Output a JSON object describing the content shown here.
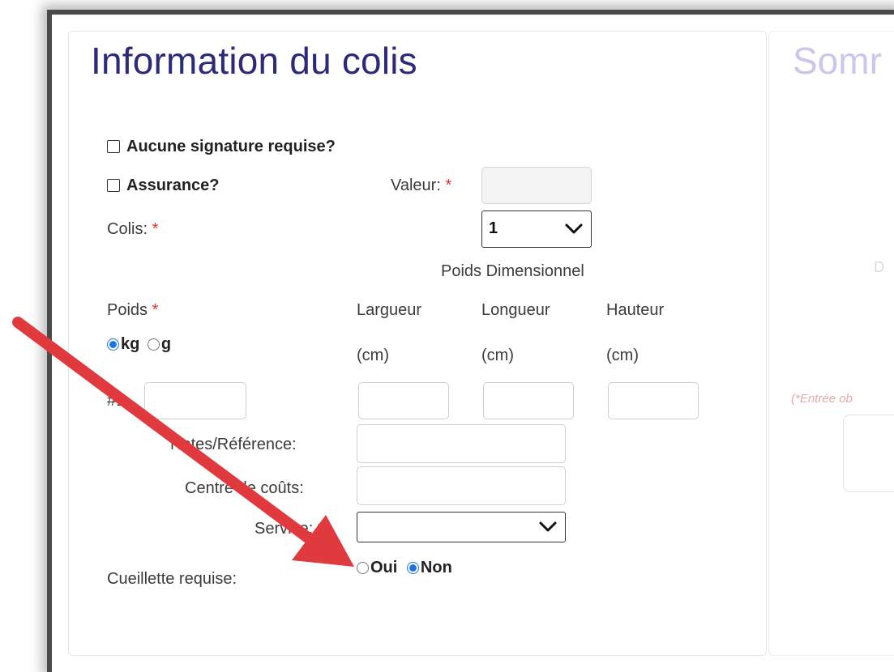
{
  "section_title": "Information du colis",
  "summary_title": "Somr",
  "options": {
    "no_signature_label": "Aucune signature requise?",
    "insurance_label": "Assurance?",
    "value_label": "Valeur:",
    "required_mark": "*"
  },
  "packages": {
    "label": "Colis:",
    "selected": "1"
  },
  "dimensional_weight_label": "Poids Dimensionnel",
  "weight": {
    "label": "Poids",
    "unit_kg": "kg",
    "unit_g": "g",
    "selected_unit": "kg"
  },
  "dimensions": {
    "width_label": "Largueur",
    "length_label": "Longueur",
    "height_label": "Hauteur",
    "unit": "(cm)"
  },
  "row": {
    "number_label": "#1:"
  },
  "notes_label": "Notes/Référence:",
  "cost_center_label": "Centre de coûts:",
  "service_label": "Service:",
  "pickup": {
    "label": "Cueillette requise:",
    "yes": "Oui",
    "no": "Non",
    "selected": "Non"
  },
  "summary_fragments": {
    "faded_label": "D",
    "required_note": "(*Entrée ob"
  },
  "colors": {
    "title": "#2c2a7a",
    "required": "#e03232",
    "radio_selected": "#1a73e8",
    "arrow": "#e0393e"
  }
}
